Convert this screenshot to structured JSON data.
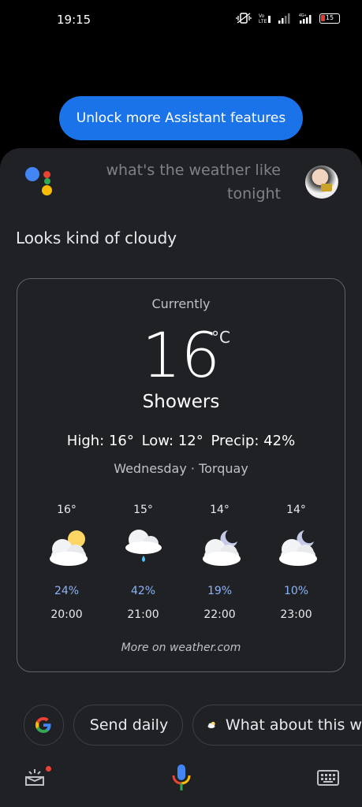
{
  "status_bar": {
    "time": "19:15",
    "battery": "15",
    "network": "4G+",
    "volte": "Vo LTE"
  },
  "banner": {
    "unlock_label": "Unlock more Assistant features"
  },
  "conversation": {
    "query": "what's the weather like tonight",
    "answer": "Looks kind of cloudy"
  },
  "weather": {
    "currently_label": "Currently",
    "temperature": "16",
    "unit": "°C",
    "condition": "Showers",
    "high": "High: 16°",
    "low": "Low: 12°",
    "precip": "Precip: 42%",
    "day_location": "Wednesday · Torquay",
    "hourly": [
      {
        "temp": "16°",
        "precip": "24%",
        "time": "20:00",
        "icon": "partly-cloudy-day-icon"
      },
      {
        "temp": "15°",
        "precip": "42%",
        "time": "21:00",
        "icon": "showers-icon"
      },
      {
        "temp": "14°",
        "precip": "19%",
        "time": "22:00",
        "icon": "partly-cloudy-night-icon"
      },
      {
        "temp": "14°",
        "precip": "10%",
        "time": "23:00",
        "icon": "partly-cloudy-night-icon"
      }
    ],
    "more_link": "More on weather.com"
  },
  "suggestions": {
    "chip1": "Send daily",
    "chip2": "What about this w"
  },
  "colors": {
    "accent": "#1a73e8",
    "precip": "#8ab4f8",
    "sheet": "#202124"
  }
}
